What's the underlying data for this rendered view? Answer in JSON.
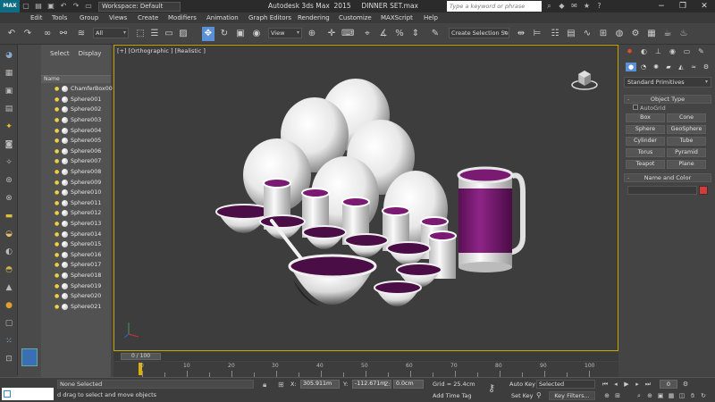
{
  "app": {
    "logo": "MAX",
    "workspace": "Workspace: Default",
    "title": "Autodesk 3ds Max  2015     DINNER SET.max",
    "search_placeholder": "Type a keyword or phrase"
  },
  "menu": [
    "Edit",
    "Tools",
    "Group",
    "Views",
    "Create",
    "Modifiers",
    "Animation",
    "Graph Editors",
    "Rendering",
    "Customize",
    "MAXScript",
    "Help"
  ],
  "toolbar": {
    "filter": "All",
    "ref_coord": "View",
    "selection_set": "Create Selection Se"
  },
  "scene_explorer": {
    "tabs": [
      "Select",
      "Display"
    ],
    "column": "Name",
    "objects": [
      "ChamferBox00",
      "Sphere001",
      "Sphere002",
      "Sphere003",
      "Sphere004",
      "Sphere005",
      "Sphere006",
      "Sphere007",
      "Sphere008",
      "Sphere009",
      "Sphere010",
      "Sphere011",
      "Sphere012",
      "Sphere013",
      "Sphere014",
      "Sphere015",
      "Sphere016",
      "Sphere017",
      "Sphere018",
      "Sphere019",
      "Sphere020",
      "Sphere021"
    ]
  },
  "viewport": {
    "label": "[+] [Orthographic ] [Realistic ]",
    "accent": "#c8a400",
    "rim_color": "#7a1a72"
  },
  "command_panel": {
    "category": "Standard Primitives",
    "object_type_title": "Object Type",
    "autogrid": "AutoGrid",
    "primitives": [
      "Box",
      "Cone",
      "Sphere",
      "GeoSphere",
      "Cylinder",
      "Tube",
      "Torus",
      "Pyramid",
      "Teapot",
      "Plane"
    ],
    "name_color_title": "Name and Color",
    "color": "#d83a3a"
  },
  "timeline": {
    "slider_label": "0 / 100",
    "ticks": [
      "0",
      "10",
      "20",
      "30",
      "40",
      "50",
      "60",
      "70",
      "80",
      "90",
      "100"
    ]
  },
  "status": {
    "selection": "None Selected",
    "prompt": "d drag to select and move objects",
    "x_label": "X:",
    "x_value": "305.911m",
    "y_label": "Y:",
    "y_value": "-112.671m",
    "z_label": "Z:",
    "z_value": "0.0cm",
    "grid": "Grid = 25.4cm",
    "add_time_tag": "Add Time Tag",
    "auto_key": "Auto Key",
    "set_key": "Set Key",
    "selected": "Selected",
    "key_filters": "Key Filters...",
    "frame": "0"
  }
}
